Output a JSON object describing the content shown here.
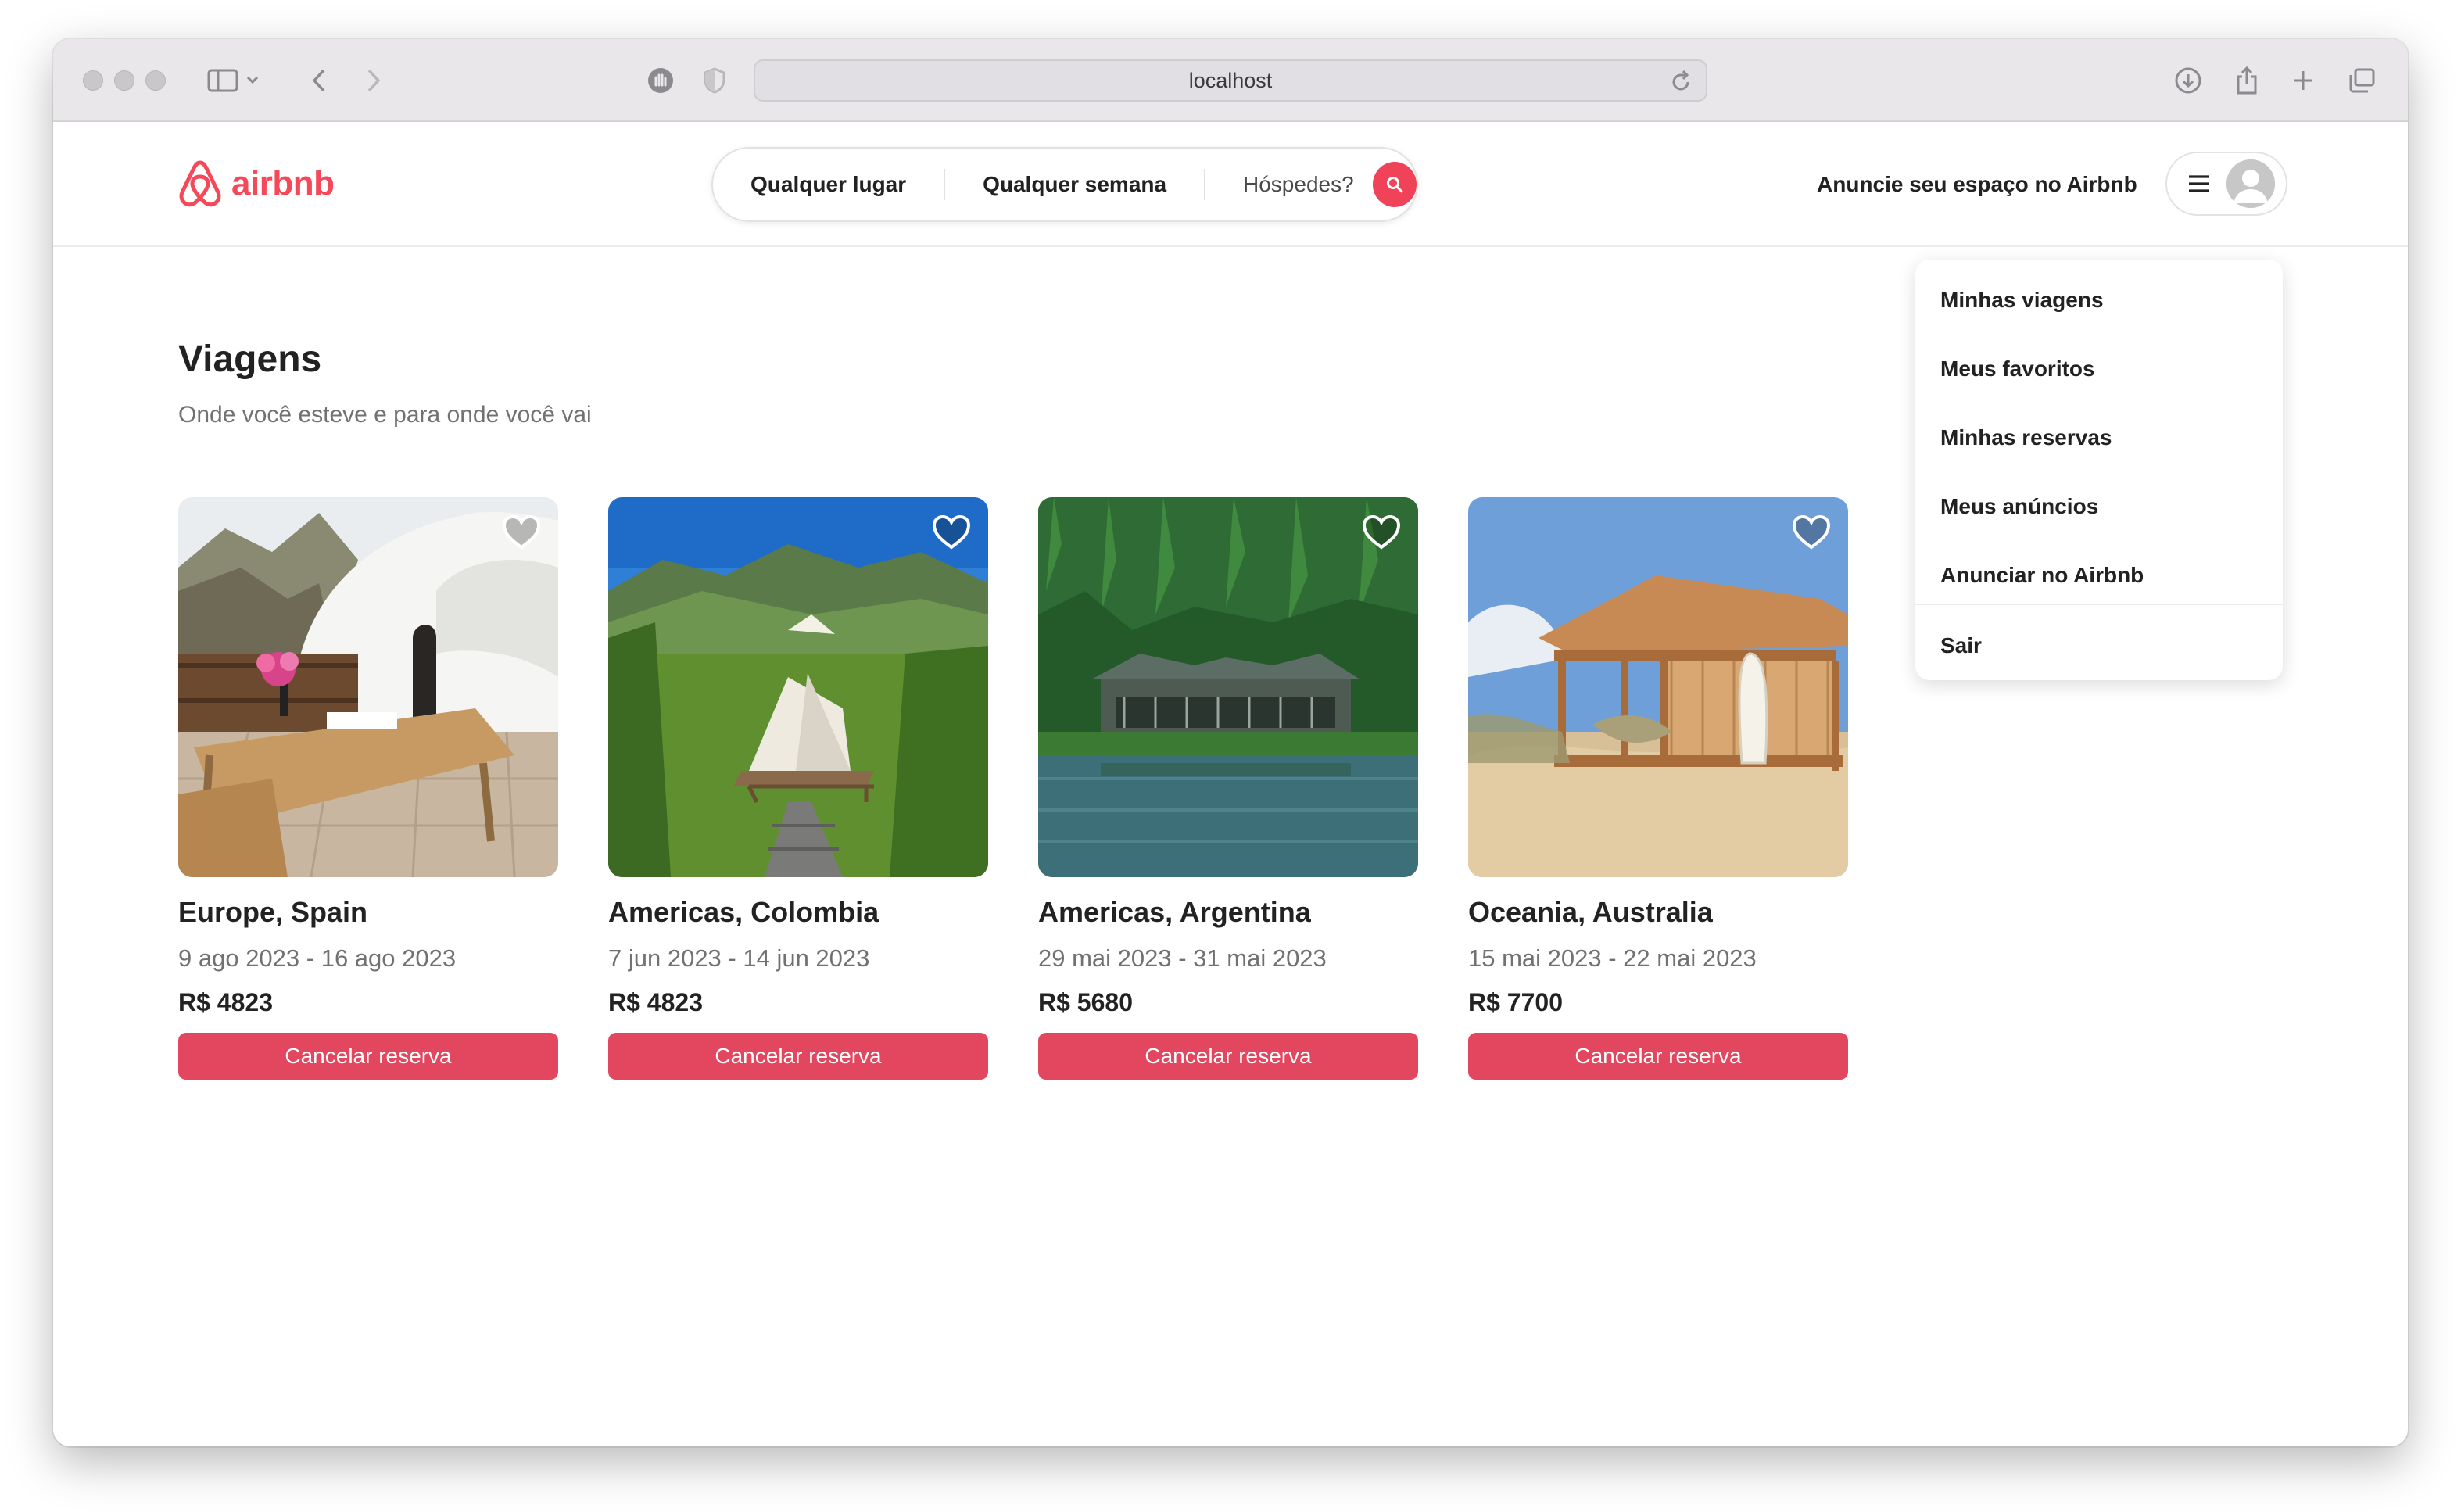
{
  "browser": {
    "url": "localhost"
  },
  "nav": {
    "logo_text": "airbnb",
    "search": {
      "anywhere": "Qualquer lugar",
      "week": "Qualquer semana",
      "guests": "Hóspedes?"
    },
    "host_link": "Anuncie seu espaço no Airbnb"
  },
  "page": {
    "title": "Viagens",
    "subtitle": "Onde você esteve e para onde você vai"
  },
  "trips": [
    {
      "location": "Europe, Spain",
      "dates": "9 ago 2023 - 16 ago 2023",
      "price": "R$ 4823",
      "cancel_label": "Cancelar reserva",
      "image": "cave-house-terrace"
    },
    {
      "location": "Americas, Colombia",
      "dates": "7 jun 2023 - 14 jun 2023",
      "price": "R$ 4823",
      "cancel_label": "Cancelar reserva",
      "image": "glamping-tent-valley"
    },
    {
      "location": "Americas, Argentina",
      "dates": "29 mai 2023 - 31 mai 2023",
      "price": "R$ 5680",
      "cancel_label": "Cancelar reserva",
      "image": "lake-lodge-forest"
    },
    {
      "location": "Oceania, Australia",
      "dates": "15 mai 2023 - 22 mai 2023",
      "price": "R$ 7700",
      "cancel_label": "Cancelar reserva",
      "image": "beach-hut-surfboard"
    }
  ],
  "user_menu": {
    "items": [
      "Minhas viagens",
      "Meus favoritos",
      "Minhas reservas",
      "Meus anúncios",
      "Anunciar no Airbnb"
    ],
    "logout": "Sair"
  },
  "colors": {
    "brand": "#f5495a",
    "cancel_button": "#e2475f"
  }
}
